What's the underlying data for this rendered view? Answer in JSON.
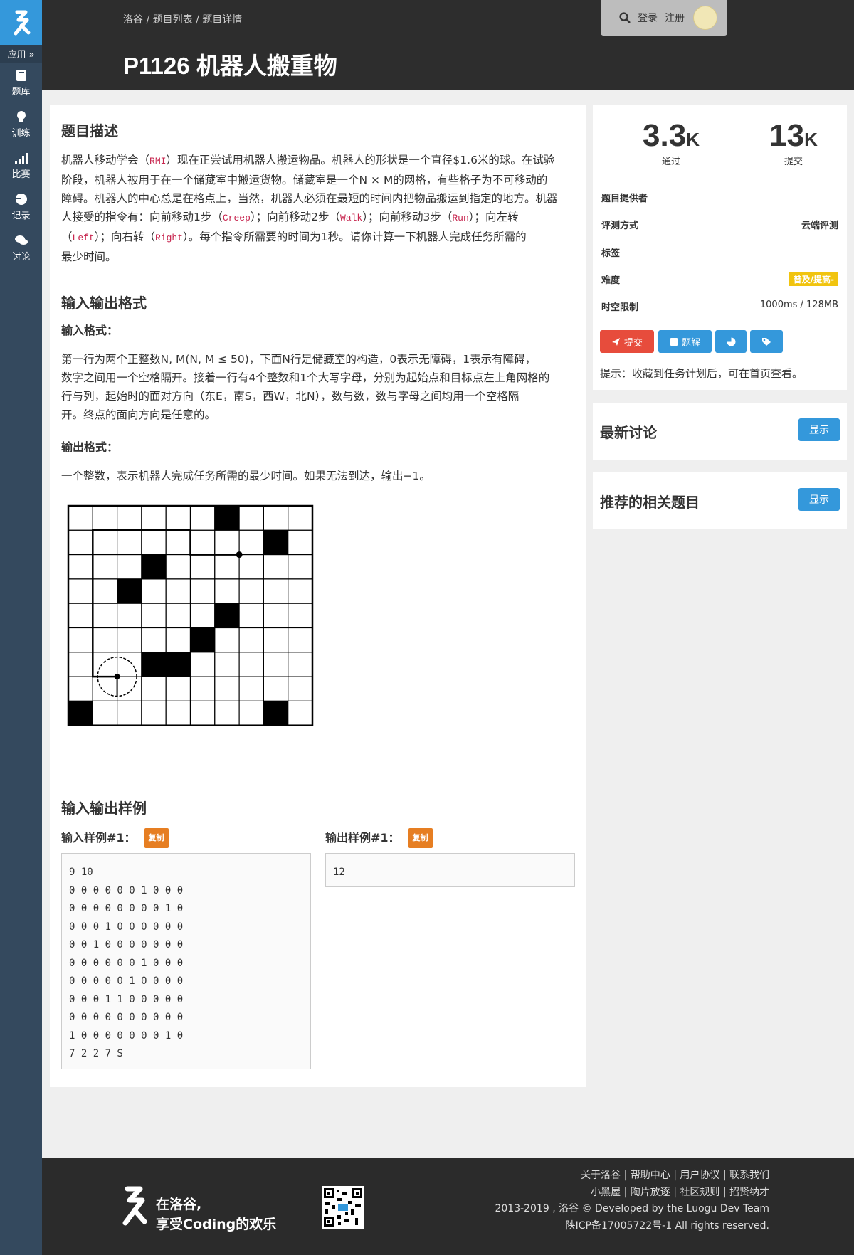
{
  "sidebar": {
    "apps_label": "应用 »",
    "items": [
      {
        "label": "题库",
        "icon": "book-icon"
      },
      {
        "label": "训练",
        "icon": "lightbulb-icon"
      },
      {
        "label": "比赛",
        "icon": "signal-bars-icon"
      },
      {
        "label": "记录",
        "icon": "pie-chart-icon"
      },
      {
        "label": "讨论",
        "icon": "comments-icon"
      }
    ]
  },
  "header": {
    "breadcrumb": "洛谷 / 题目列表 / 题目详情",
    "title": "P1126 机器人搬重物",
    "login_label": "登录",
    "register_label": "注册"
  },
  "problem": {
    "desc_heading": "题目描述",
    "desc_line1_a": "机器人移动学会（",
    "desc_rmi": "RMI",
    "desc_line1_b": "）现在正尝试用机器人搬运物品。机器人的形状是一个直径$1.6米的球。在试验",
    "desc_line2": "阶段，机器人被用于在一个储藏室中搬运货物。储藏室是一个N × M的网格，有些格子为不可移动的",
    "desc_line3": "障碍。机器人的中心总是在格点上，当然，机器人必须在最短的时间内把物品搬运到指定的地方。机器",
    "desc_line4_a": "人接受的指令有：向前移动1步（",
    "creep": "Creep",
    "desc_line4_b": "）；向前移动2步（",
    "walk": "Walk",
    "desc_line4_c": "）；向前移动3步（",
    "run": "Run",
    "desc_line4_d": "）；向左转",
    "desc_line5_a": "（",
    "left": "Left",
    "desc_line5_b": "）；向右转（",
    "right": "Right",
    "desc_line5_c": "）。每个指令所需要的时间为1秒。请你计算一下机器人完成任务所需的",
    "desc_line6": "最少时间。",
    "io_heading": "输入输出格式",
    "input_label": "输入格式：",
    "input_line1": "第一行为两个正整数N, M(N, M ≤ 50)，下面N行是储藏室的构造，0表示无障碍，1表示有障碍，",
    "input_line2": "数字之间用一个空格隔开。接着一行有4个整数和1个大写字母，分别为起始点和目标点左上角网格的",
    "input_line3": "行与列，起始时的面对方向（东E，南S，西W，北N），数与数，数与字母之间均用一个空格隔",
    "input_line4": "开。终点的面向方向是任意的。",
    "output_label": "输出格式：",
    "output_line": "一个整数，表示机器人完成任务所需的最少时间。如果无法到达，输出−1。",
    "samples_heading": "输入输出样例",
    "sample_in_label": "输入样例#1：",
    "sample_out_label": "输出样例#1：",
    "copy_label": "复制",
    "sample_in": "9 10\n0 0 0 0 0 0 1 0 0 0\n0 0 0 0 0 0 0 0 1 0\n0 0 0 1 0 0 0 0 0 0\n0 0 1 0 0 0 0 0 0 0\n0 0 0 0 0 0 1 0 0 0\n0 0 0 0 0 1 0 0 0 0\n0 0 0 1 1 0 0 0 0 0\n0 0 0 0 0 0 0 0 0 0\n1 0 0 0 0 0 0 0 1 0\n7 2 2 7 S",
    "sample_out": "12",
    "grid": [
      [
        0,
        0,
        0,
        0,
        0,
        0,
        1,
        0,
        0,
        0
      ],
      [
        0,
        0,
        0,
        0,
        0,
        0,
        0,
        0,
        1,
        0
      ],
      [
        0,
        0,
        0,
        1,
        0,
        0,
        0,
        0,
        0,
        0
      ],
      [
        0,
        0,
        1,
        0,
        0,
        0,
        0,
        0,
        0,
        0
      ],
      [
        0,
        0,
        0,
        0,
        0,
        0,
        1,
        0,
        0,
        0
      ],
      [
        0,
        0,
        0,
        0,
        0,
        1,
        0,
        0,
        0,
        0
      ],
      [
        0,
        0,
        0,
        1,
        1,
        0,
        0,
        0,
        0,
        0
      ],
      [
        0,
        0,
        0,
        0,
        0,
        0,
        0,
        0,
        0,
        0
      ],
      [
        1,
        0,
        0,
        0,
        0,
        0,
        0,
        0,
        1,
        0
      ]
    ]
  },
  "stats": {
    "passed_value": "3.3",
    "passed_unit": "K",
    "passed_label": "通过",
    "submit_value": "13",
    "submit_unit": "K",
    "submit_label": "提交"
  },
  "info": {
    "provider_key": "题目提供者",
    "provider_value": "",
    "judge_key": "评测方式",
    "judge_value": "云端评测",
    "tags_key": "标签",
    "difficulty_key": "难度",
    "difficulty_value": "普及/提高-",
    "limit_key": "时空限制",
    "limit_value": "1000ms / 128MB",
    "submit_btn": "提交",
    "solution_btn": "题解",
    "tip": "提示：收藏到任务计划后，可在首页查看。"
  },
  "discuss": {
    "title": "最新讨论",
    "show": "显示"
  },
  "related": {
    "title": "推荐的相关题目",
    "show": "显示"
  },
  "footer": {
    "slogan_line1": "在洛谷,",
    "slogan_line2": "享受Coding的欢乐",
    "links1": "关于洛谷 | 帮助中心 | 用户协议 | 联系我们",
    "links2": "小黑屋 | 陶片放逐 | 社区规则 | 招贤纳才",
    "copyright": "2013-2019 , 洛谷 © Developed by the Luogu Dev Team",
    "icp": "陕ICP备17005722号-1 All rights reserved."
  },
  "colors": {
    "sidebar": "#34495e",
    "brand": "#3498db",
    "danger": "#e74c3c",
    "warning": "#e67e22",
    "difficulty": "#f1c40f"
  }
}
